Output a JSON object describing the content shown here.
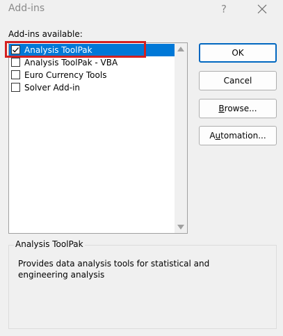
{
  "window": {
    "title": "Add-ins",
    "help_label": "?"
  },
  "addins": {
    "label": "Add-ins available:",
    "items": [
      {
        "label": "Analysis ToolPak",
        "checked": true,
        "selected": true
      },
      {
        "label": "Analysis ToolPak - VBA",
        "checked": false,
        "selected": false
      },
      {
        "label": "Euro Currency Tools",
        "checked": false,
        "selected": false
      },
      {
        "label": "Solver Add-in",
        "checked": false,
        "selected": false
      }
    ]
  },
  "buttons": {
    "ok": "OK",
    "cancel": "Cancel",
    "browse": {
      "mnemonic": "B",
      "rest": "rowse..."
    },
    "automation": {
      "mnemonic": "u",
      "prefix": "A",
      "rest": "tomation..."
    }
  },
  "description": {
    "title": "Analysis ToolPak",
    "text": "Provides data analysis tools for statistical and engineering analysis"
  },
  "colors": {
    "selection": "#0078d7",
    "highlight_box": "#d32020",
    "default_button_border": "#0067c0"
  },
  "icons": {
    "close": "close-icon",
    "check": "checkmark-icon",
    "scroll_up": "triangle-up-icon",
    "scroll_down": "triangle-down-icon"
  }
}
